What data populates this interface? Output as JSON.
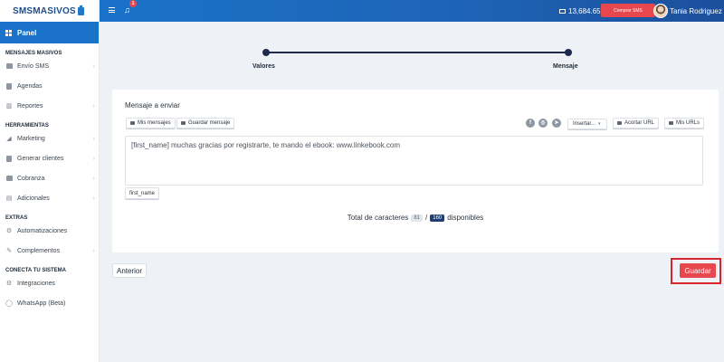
{
  "brand": {
    "logo_text": "SMSMASIVOS"
  },
  "sidebar": {
    "panel_label": "Panel",
    "sections": [
      {
        "title": "MENSAJES MASIVOS",
        "items": [
          {
            "label": "Envío SMS",
            "icon": "chat-icon",
            "has_chevron": true
          },
          {
            "label": "Agendas",
            "icon": "address-book-icon",
            "has_chevron": false
          },
          {
            "label": "Reportes",
            "icon": "chart-icon",
            "has_chevron": true
          }
        ]
      },
      {
        "title": "HERRAMIENTAS",
        "items": [
          {
            "label": "Marketing",
            "icon": "megaphone-icon",
            "has_chevron": true
          },
          {
            "label": "Generar clientes",
            "icon": "clipboard-icon",
            "has_chevron": true
          },
          {
            "label": "Cobranza",
            "icon": "billing-icon",
            "has_chevron": true
          },
          {
            "label": "Adicionales",
            "icon": "layers-icon",
            "has_chevron": true
          }
        ]
      },
      {
        "title": "EXTRAS",
        "items": [
          {
            "label": "Automatizaciones",
            "icon": "automation-icon",
            "has_chevron": false
          },
          {
            "label": "Complementos",
            "icon": "wrench-icon",
            "has_chevron": true
          }
        ]
      },
      {
        "title": "CONECTA TU SISTEMA",
        "items": [
          {
            "label": "Integraciones",
            "icon": "gear-icon",
            "has_chevron": false
          },
          {
            "label": "WhatsApp (Beta)",
            "icon": "whatsapp-icon",
            "has_chevron": false
          }
        ]
      }
    ]
  },
  "topbar": {
    "notification_count": "1",
    "balance": "13,684.65",
    "buy_button": "Comprar SMS",
    "user_name": "Tania Rodriguez"
  },
  "wizard": {
    "steps": [
      "Valores",
      "Mensaje"
    ]
  },
  "card": {
    "title": "Mensaje a enviar",
    "btn_mis_mensajes": "Mis mensajes",
    "btn_guardar_mensaje": "Guardar mensaje",
    "insert_select": "Insertar...",
    "btn_acortar": "Acortar URL",
    "btn_mis_urls": "Mis URLs",
    "message_text": "[first_name] muchas gracias por registrarte, te mando el ebook: www.linkebook.com",
    "tag_button": "first_name",
    "char_prefix": "Total de caracteres",
    "char_used": "81",
    "char_sep": "/",
    "char_total": "160",
    "char_suffix": "disponibles"
  },
  "footer": {
    "prev_button": "Anterior",
    "save_button": "Guardar"
  },
  "colors": {
    "primary": "#1a73c9",
    "danger": "#e8474e",
    "navy": "#1d2b4a"
  }
}
